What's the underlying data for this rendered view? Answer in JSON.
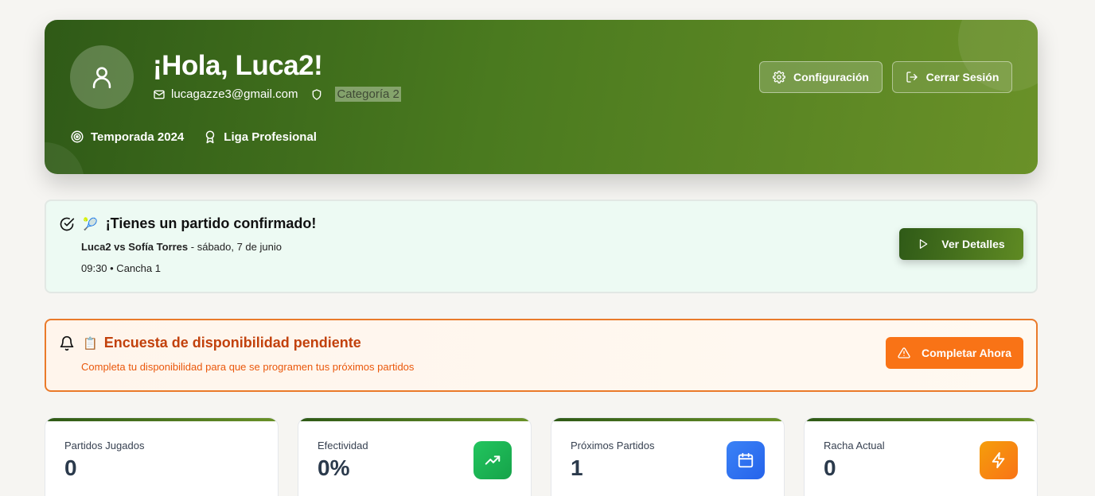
{
  "header": {
    "greeting": "¡Hola, Luca2!",
    "email": "lucagazze3@gmail.com",
    "category": "Categoría 2",
    "season": "Temporada 2024",
    "league": "Liga Profesional",
    "config_label": "Configuración",
    "logout_label": "Cerrar Sesión"
  },
  "match_card": {
    "title": "¡Tienes un partido confirmado!",
    "emoji": "🎾",
    "players": "Luca2 vs Sofía Torres",
    "date": " - sábado, 7 de junio",
    "time_court": "09:30 • Cancha 1",
    "button_label": "Ver Detalles"
  },
  "survey_card": {
    "title": "Encuesta de disponibilidad pendiente",
    "emoji": "📋",
    "subtitle": "Completa tu disponibilidad para que se programen tus próximos partidos",
    "button_label": "Completar Ahora"
  },
  "stats": [
    {
      "label": "Partidos Jugados",
      "value": "0",
      "icon": "none"
    },
    {
      "label": "Efectividad",
      "value": "0%",
      "icon": "trending-up-icon",
      "color": "#22c55e"
    },
    {
      "label": "Próximos Partidos",
      "value": "1",
      "icon": "calendar-icon",
      "color": "#3b82f6"
    },
    {
      "label": "Racha Actual",
      "value": "0",
      "icon": "lightning-icon",
      "color": "#f59e0b"
    }
  ],
  "colors": {
    "brand_dark": "#2f5a17",
    "brand_light": "#6a9128",
    "orange": "#f97316"
  }
}
